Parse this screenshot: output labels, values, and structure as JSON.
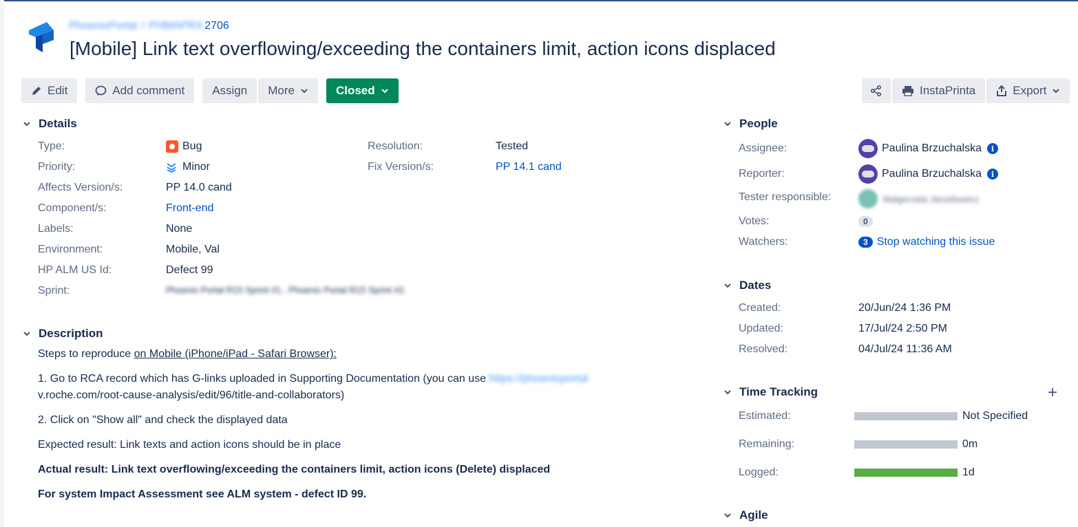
{
  "issue": {
    "breadcrumb_project": "PhoenixPortal",
    "breadcrumb_key_prefix": "PHMAPRX",
    "breadcrumb_number": "2706",
    "title": "[Mobile] Link text overflowing/exceeding the containers limit, action icons displaced"
  },
  "toolbar": {
    "edit": "Edit",
    "add_comment": "Add comment",
    "assign": "Assign",
    "more": "More",
    "status": "Closed",
    "instaprinta": "InstaPrinta",
    "export": "Export"
  },
  "details": {
    "heading": "Details",
    "type_label": "Type:",
    "type_value": "Bug",
    "priority_label": "Priority:",
    "priority_value": "Minor",
    "affects_label": "Affects Version/s:",
    "affects_value": "PP 14.0 cand",
    "component_label": "Component/s:",
    "component_value": "Front-end",
    "labels_label": "Labels:",
    "labels_value": "None",
    "environment_label": "Environment:",
    "environment_value": "Mobile, Val",
    "hpalm_label": "HP ALM US Id:",
    "hpalm_value": "Defect 99",
    "sprint_label": "Sprint:",
    "sprint_value": "Phoenix Portal R15 Sprint #1 , Phoenix Portal R15 Sprint #2",
    "resolution_label": "Resolution:",
    "resolution_value": "Tested",
    "fixversion_label": "Fix Version/s:",
    "fixversion_value": "PP 14.1 cand"
  },
  "description": {
    "heading": "Description",
    "steps_prefix": "Steps to reproduce ",
    "steps_underlined": "on Mobile (iPhone/iPad - Safari Browser):",
    "step1": "1. Go to RCA record which has G-links uploaded in Supporting Documentation (you can use ",
    "step1_link_blurred": "https://phoenixportal",
    "step1_link_line2": "v.roche.com/root-cause-analysis/edit/96/title-and-collaborators)",
    "step2": "2. Click on \"Show all\" and check the displayed data",
    "expected": "Expected result: Link texts and action icons should be in place",
    "actual": "Actual result: Link text overflowing/exceeding the containers limit, action icons (Delete) displaced",
    "impact": "For system Impact Assessment see ALM system - defect ID 99."
  },
  "people": {
    "heading": "People",
    "assignee_label": "Assignee:",
    "assignee_value": "Paulina Brzuchalska",
    "reporter_label": "Reporter:",
    "reporter_value": "Paulina Brzuchalska",
    "tester_label": "Tester responsible:",
    "tester_value": "Malgorzata Jarzebowicz",
    "votes_label": "Votes:",
    "votes_value": "0",
    "watchers_label": "Watchers:",
    "watchers_count": "3",
    "watchers_link": "Stop watching this issue"
  },
  "dates": {
    "heading": "Dates",
    "created_label": "Created:",
    "created_value": "20/Jun/24 1:36 PM",
    "updated_label": "Updated:",
    "updated_value": "17/Jul/24 2:50 PM",
    "resolved_label": "Resolved:",
    "resolved_value": "04/Jul/24 11:36 AM"
  },
  "time_tracking": {
    "heading": "Time Tracking",
    "add_symbol": "+",
    "estimated_label": "Estimated:",
    "estimated_value": "Not Specified",
    "remaining_label": "Remaining:",
    "remaining_value": "0m",
    "logged_label": "Logged:",
    "logged_value": "1d",
    "logged_fraction": 1.0
  },
  "agile": {
    "heading": "Agile"
  },
  "colors": {
    "accent": "#0052cc",
    "status_green": "#00875a",
    "bug_red": "#ff5630",
    "logged_green": "#5aac44"
  }
}
